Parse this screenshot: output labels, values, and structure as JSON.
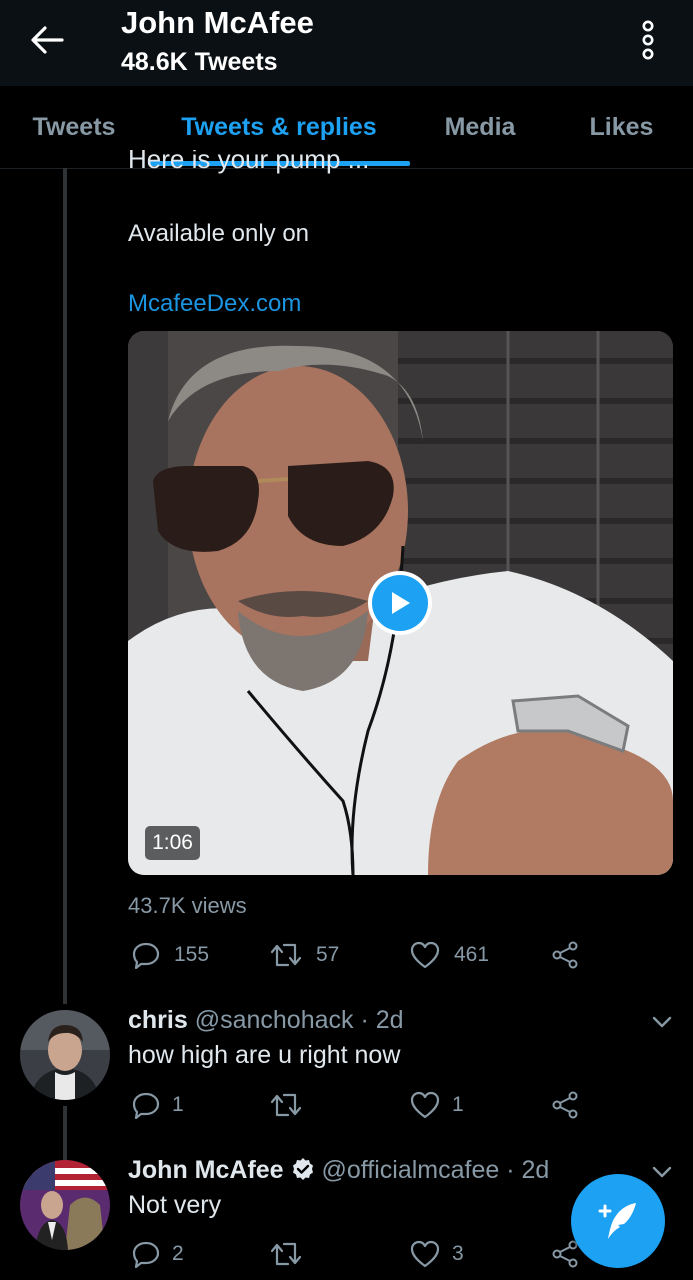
{
  "header": {
    "title": "John McAfee",
    "subtitle": "48.6K Tweets",
    "back_icon": "arrow-left-icon",
    "more_icon": "more-vertical-icon"
  },
  "tabs": [
    {
      "label": "Tweets",
      "active": false
    },
    {
      "label": "Tweets & replies",
      "active": true
    },
    {
      "label": "Media",
      "active": false
    },
    {
      "label": "Likes",
      "active": false
    }
  ],
  "tweet": {
    "clipped_text": "Here is your pump ...",
    "text_line": "Available only on",
    "link": "McafeeDex.com",
    "video_duration": "1:06",
    "views": "43.7K views",
    "replies": "155",
    "retweets": "57",
    "likes": "461"
  },
  "replies": [
    {
      "name": "chris",
      "handle": "@sanchohack",
      "time": "· 2d",
      "text": "how high are u right now",
      "replies": "1",
      "retweets": "",
      "likes": "1",
      "verified": false
    },
    {
      "name": "John McAfee",
      "handle": "@officialmcafee",
      "time": "· 2d",
      "text": "Not very",
      "replies": "2",
      "retweets": "",
      "likes": "3",
      "verified": true
    }
  ],
  "fab_icon": "compose-tweet-icon",
  "colors": {
    "accent": "#1da1f2",
    "header_bg": "#0a1014",
    "background": "#000000",
    "muted": "#8899a6"
  }
}
